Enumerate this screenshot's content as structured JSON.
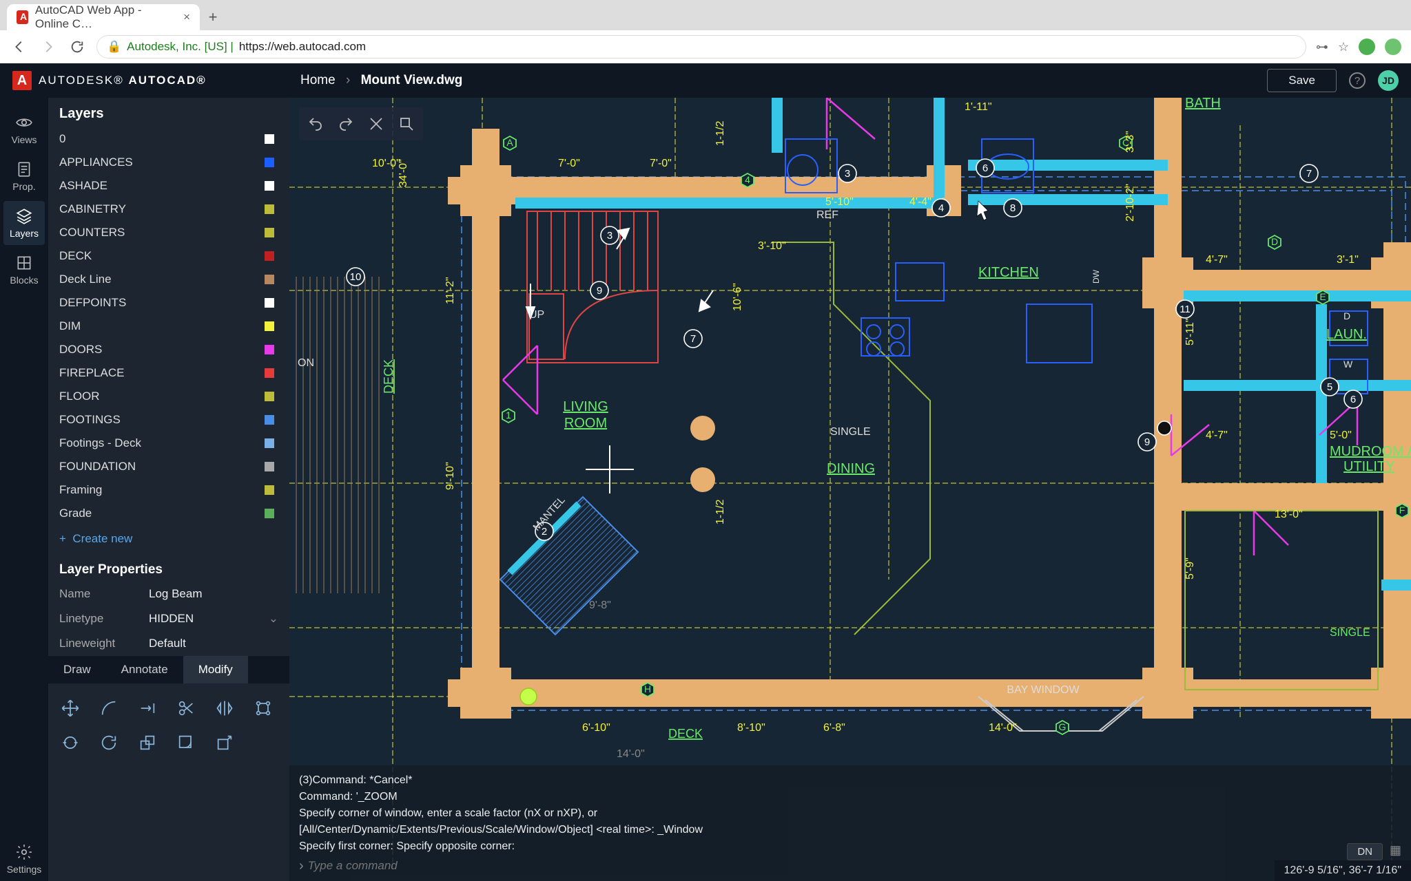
{
  "browser": {
    "tab_title": "AutoCAD Web App - Online C…",
    "url_prefix": "Autodesk, Inc. [US] | ",
    "url": "https://web.autocad.com"
  },
  "header": {
    "logo_text_1": "AUTODESK®",
    "logo_text_2": "AUTOCAD®",
    "breadcrumb_home": "Home",
    "breadcrumb_sep": "›",
    "breadcrumb_file": "Mount View.dwg",
    "save_label": "Save",
    "user_initials": "JD"
  },
  "rail": {
    "items": [
      {
        "label": "Views"
      },
      {
        "label": "Prop."
      },
      {
        "label": "Layers"
      },
      {
        "label": "Blocks"
      }
    ],
    "settings_label": "Settings"
  },
  "layers_panel": {
    "title": "Layers",
    "items": [
      {
        "name": "0",
        "color": "#ffffff"
      },
      {
        "name": "APPLIANCES",
        "color": "#1a5fff"
      },
      {
        "name": "ASHADE",
        "color": "#ffffff"
      },
      {
        "name": "CABINETRY",
        "color": "#bcbc3a"
      },
      {
        "name": "COUNTERS",
        "color": "#bcbc3a"
      },
      {
        "name": "DECK",
        "color": "#c02020"
      },
      {
        "name": "Deck Line",
        "color": "#b88760"
      },
      {
        "name": "DEFPOINTS",
        "color": "#ffffff"
      },
      {
        "name": "DIM",
        "color": "#f2f23a"
      },
      {
        "name": "DOORS",
        "color": "#e83ae8"
      },
      {
        "name": "FIREPLACE",
        "color": "#e83a3a"
      },
      {
        "name": "FLOOR",
        "color": "#bcbc3a"
      },
      {
        "name": "FOOTINGS",
        "color": "#4a8de8"
      },
      {
        "name": "Footings - Deck",
        "color": "#7ab0e8"
      },
      {
        "name": "FOUNDATION",
        "color": "#a8a8a8"
      },
      {
        "name": "Framing",
        "color": "#bcbc3a"
      },
      {
        "name": "Grade",
        "color": "#5aaf5a"
      }
    ],
    "create_label": "Create new"
  },
  "layer_props": {
    "title": "Layer Properties",
    "rows": [
      {
        "label": "Name",
        "value": "Log Beam"
      },
      {
        "label": "Linetype",
        "value": "HIDDEN",
        "select": true
      },
      {
        "label": "Lineweight",
        "value": "Default"
      }
    ]
  },
  "tabs": {
    "items": [
      "Draw",
      "Annotate",
      "Modify"
    ],
    "active": 2
  },
  "command": {
    "lines": [
      "(3)Command: *Cancel*",
      "Command: '_ZOOM",
      "Specify corner of window, enter a scale factor (nX or nXP), or",
      "[All/Center/Dynamic/Extents/Previous/Scale/Window/Object] <real time>:  _Window",
      "Specify first corner: Specify opposite corner:"
    ],
    "placeholder": "Type a command"
  },
  "status": {
    "coords": "126'-9 5/16\", 36'-7 1/16\"",
    "hatch_dn": "DN"
  },
  "drawing": {
    "rooms": {
      "bath": "BATH",
      "kitchen": "KITCHEN",
      "living": "LIVING ROOM",
      "dining": "DINING",
      "laundry": "LAUN.",
      "mudroom": "MUDROOM / UTILITY"
    },
    "labels": {
      "ref": "REF",
      "up": "UP",
      "single": "SINGLE",
      "mantel": "MANTEL",
      "bay": "BAY  WINDOW",
      "deck_v": "DECK",
      "deck_b": "DECK",
      "on": "ON",
      "d": "D",
      "w": "W",
      "dw": "DW",
      "single2": "SINGLE"
    },
    "dims": {
      "d10_0": "10'-0\"",
      "d7_0": "7'-0\"",
      "d7_0b": "7'-0\"",
      "d34_0": "34'-0\"",
      "d11_2": "11'-2\"",
      "d9_10": "9'-10\"",
      "d1_1_2": "1-1/2",
      "d1_11": "1'-11\"",
      "d3_10": "3'-10\"",
      "d10_6": "10'-6\"",
      "d1_1_2b": "1-1/2",
      "d5_10": "5'-10\"",
      "d4_4": "4'-4\"",
      "d3_3": "3'-3\"",
      "d2_10_2": "2'-10-2\"",
      "d4_7": "4'-7\"",
      "d3_1": "3'-1\"",
      "d5_11": "5'-11\"",
      "d4_7b": "4'-7\"",
      "d5_0": "5'-0\"",
      "d13_0": "13'-0\"",
      "d5_9": "5'-9\"",
      "d6_8": "6'-8\"",
      "d14_0": "14'-0\"",
      "d6_10": "6'-10\"",
      "d9_8": "9'-8\"",
      "d8_10": "8'-10\"",
      "d14_0b": "14'-0\""
    }
  }
}
